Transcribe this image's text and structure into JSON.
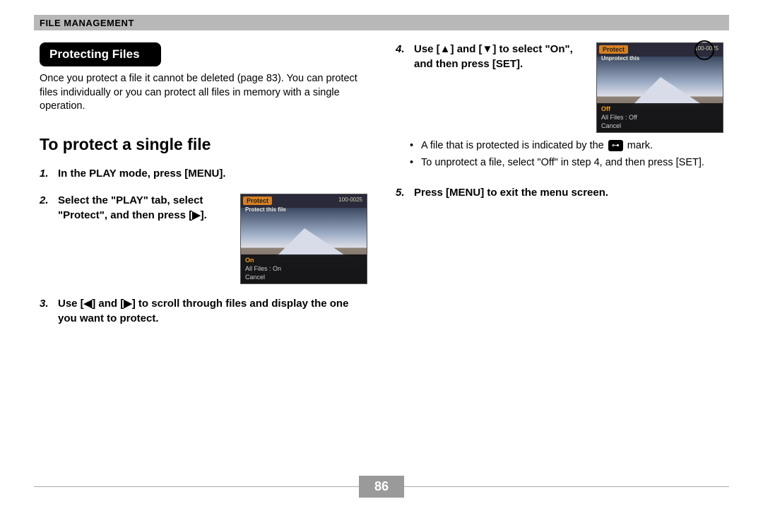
{
  "header": {
    "section_title": "File Management"
  },
  "left": {
    "heading": "Protecting Files",
    "intro": "Once you protect a file it cannot be deleted (page 83). You can protect files individually or you can protect all files in memory with a single operation.",
    "subheading": "To protect a single file",
    "step1": {
      "num": "1.",
      "text": "In the PLAY mode, press [MENU]."
    },
    "step2": {
      "num": "2.",
      "text": "Select the \"PLAY\" tab, select \"Protect\", and then press [▶]."
    },
    "step3": {
      "num": "3.",
      "text": "Use [◀] and [▶] to scroll through files and display the one you want to protect."
    },
    "thumb1": {
      "tab": "Protect",
      "topright": "100-0025",
      "sub": "Protect this file",
      "menu_l1": "On",
      "menu_l2": "All Files : On",
      "menu_l3": "Cancel"
    }
  },
  "right": {
    "step4": {
      "num": "4.",
      "text": "Use [▲] and [▼] to select \"On\", and then press [SET]."
    },
    "bullet1_a": "A file that is protected is indicated by the",
    "bullet1_b": "mark.",
    "bullet2": "To unprotect a file, select \"Off\" in step 4, and then press [SET].",
    "step5": {
      "num": "5.",
      "text": "Press [MENU] to exit the menu screen."
    },
    "thumb2": {
      "tab": "Protect",
      "topright": "100-0025",
      "sub": "Unprotect this",
      "menu_l1": "Off",
      "menu_l2": "All Files : Off",
      "menu_l3": "Cancel"
    },
    "key_icon": "⊶"
  },
  "page_number": "86"
}
